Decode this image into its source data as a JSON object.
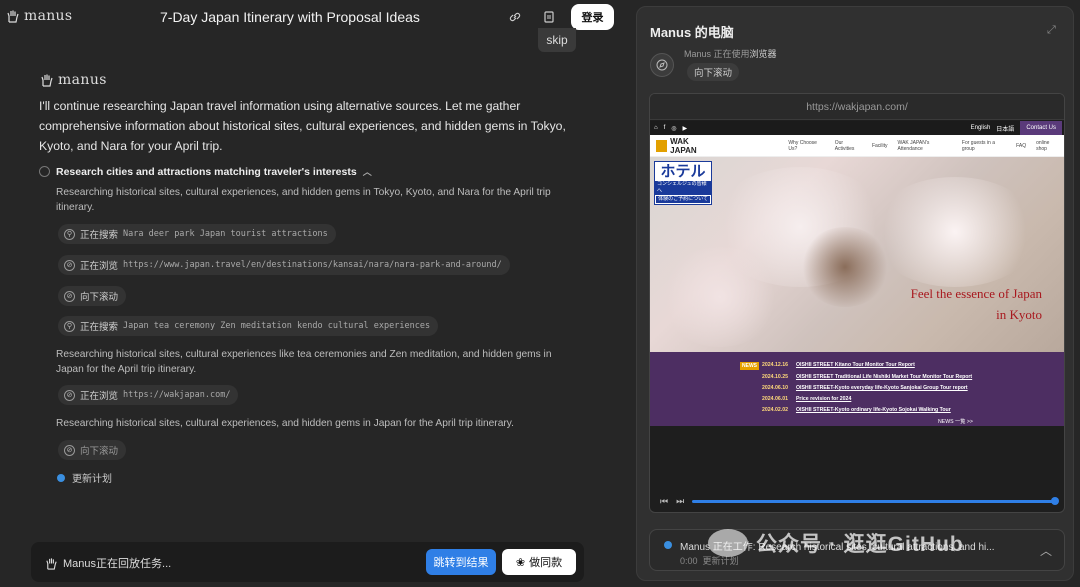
{
  "header": {
    "brand": "manus",
    "title": "7-Day Japan Itinerary with Proposal Ideas",
    "login": "登录",
    "skip": "skip"
  },
  "chat": {
    "brand": "manus",
    "intro": "I'll continue researching Japan travel information using alternative sources. Let me gather comprehensive information about historical sites, cultural experiences, and hidden gems in Tokyo, Kyoto, and Nara for your April trip.",
    "task_title": "Research cities and attractions matching traveler's interests",
    "para1": "Researching historical sites, cultural experiences, and hidden gems in Tokyo, Kyoto, and Nara for the April trip itinerary.",
    "steps": [
      {
        "action": "正在搜索",
        "detail": "Nara deer park Japan tourist attractions",
        "icon": "search-icon"
      },
      {
        "action": "正在浏览",
        "detail": "https://www.japan.travel/en/destinations/kansai/nara/nara-park-and-around/",
        "icon": "compass-icon"
      },
      {
        "action": "向下滚动",
        "detail": "",
        "icon": "compass-icon"
      },
      {
        "action": "正在搜索",
        "detail": "Japan tea ceremony Zen meditation kendo cultural experiences",
        "icon": "search-icon"
      }
    ],
    "para2": "Researching historical sites, cultural experiences like tea ceremonies and Zen meditation, and hidden gems in Japan for the April trip itinerary.",
    "step5": {
      "action": "正在浏览",
      "detail": "https://wakjapan.com/"
    },
    "para3": "Researching historical sites, cultural experiences, and hidden gems in Japan for the April trip itinerary.",
    "step6": {
      "action": "向下滚动"
    },
    "plan": "更新计划"
  },
  "bottom": {
    "replay": "Manus正在回放任务...",
    "jump": "跳转到结果",
    "same": "做同款"
  },
  "panel": {
    "title": "Manus 的电脑",
    "using_prefix": "Manus 正在使用",
    "using_tool": "浏览器",
    "action": "向下滚动",
    "url": "https://wakjapan.com/",
    "site": {
      "lang1": "English",
      "lang2": "日本語",
      "contact": "Contact Us",
      "logo": "WAK JAPAN",
      "nav": [
        "Why Choose Us?",
        "Our Activities",
        "Facility",
        "WAK JAPAN's Attendance",
        "For guests in a group",
        "FAQ",
        "online shop"
      ],
      "hotel_big": "ホテル",
      "hotel_sm1": "コンシェルジュの皆様へ",
      "hotel_sm2": "体験のご予約について",
      "tagline1": "Feel the essence of Japan",
      "tagline2": "in Kyoto",
      "news_tag": "NEWS",
      "news": [
        {
          "date": "2024.12.16",
          "text": "OISHII STREET Kitano Tour Monitor Tour Report"
        },
        {
          "date": "2024.10.25",
          "text": "OISHII STREET Traditional Life Nishiki Market Tour Monitor Tour Report"
        },
        {
          "date": "2024.06.10",
          "text": "OISHII STREET-Kyoto everyday life-Kyoto Sanjokai Group Tour report"
        },
        {
          "date": "2024.06.01",
          "text": "Price revision for 2024"
        },
        {
          "date": "2024.02.02",
          "text": "OISHII STREET-Kyoto ordinary life-Kyoto Sojokai Walking Tour"
        }
      ],
      "news_more": "NEWS 一覧 >>"
    },
    "status": "Manus 正在工作: Research historical sites, cultural attractions, and hi...",
    "time": "0:00",
    "status_sub": "更新计划"
  },
  "watermark": "公众号 · 逛逛GitHub"
}
